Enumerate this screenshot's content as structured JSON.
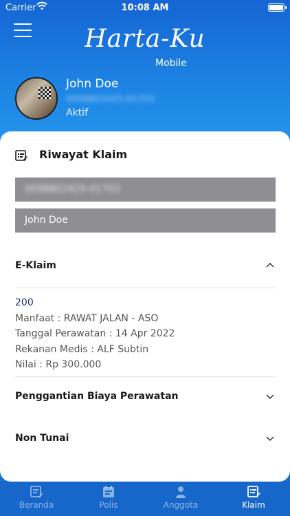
{
  "status_bar": {
    "carrier": "Carrier",
    "time": "10:08 AM"
  },
  "header": {
    "logo": "Harta-Ku",
    "logo_sub": "Mobile"
  },
  "profile": {
    "name": "John Doe",
    "member_id": "0098802425-01703",
    "status": "Aktif"
  },
  "card": {
    "title": "Riwayat Klaim",
    "member_id_value": "0098802425-01703",
    "member_name_value": "John Doe",
    "sections": [
      {
        "label": "E-Klaim",
        "expanded": true
      },
      {
        "label": "Penggantian Biaya Perawatan",
        "expanded": false
      },
      {
        "label": "Non Tunai",
        "expanded": false
      }
    ],
    "claim": {
      "code": "200",
      "manfaat": "Manfaat : RAWAT JALAN - ASO",
      "tanggal": "Tanggal Perawatan : 14 Apr 2022",
      "rekanan": "Rekanan Medis : ALF Subtin",
      "nilai": "Nilai : Rp 300.000"
    }
  },
  "tabs": [
    {
      "label": "Beranda",
      "icon": "home-doc-icon",
      "active": false
    },
    {
      "label": "Polis",
      "icon": "policy-icon",
      "active": false
    },
    {
      "label": "Anggota",
      "icon": "person-icon",
      "active": false
    },
    {
      "label": "Klaim",
      "icon": "claim-icon",
      "active": true
    }
  ],
  "colors": {
    "header_blue": "#1e88e5",
    "tabbar": "#1766c9",
    "field_gray": "#8e8e93",
    "claim_code": "#1a2f6b"
  }
}
